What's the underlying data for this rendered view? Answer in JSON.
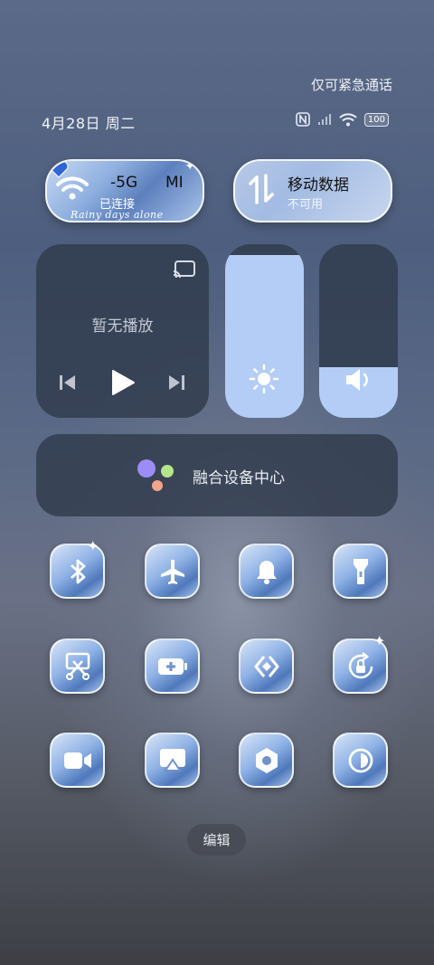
{
  "status": {
    "emergency_text": "仅可紧急通话",
    "date": "4月28日 周二",
    "battery": "100"
  },
  "wifi_tile": {
    "network": "-5G",
    "mi_text": "MI",
    "status": "已连接",
    "script_text": "Rainy days alone"
  },
  "mobile_data_tile": {
    "title": "移动数据",
    "status": "不可用"
  },
  "media": {
    "label": "暂无播放"
  },
  "brightness": {
    "level": 0.94
  },
  "volume": {
    "level": 0.29
  },
  "fusion": {
    "label": "融合设备中心"
  },
  "toggles": [
    {
      "icon": "bluetooth-icon"
    },
    {
      "icon": "airplane-icon"
    },
    {
      "icon": "bell-icon"
    },
    {
      "icon": "flashlight-icon"
    },
    {
      "icon": "screenshot-icon"
    },
    {
      "icon": "battery-saver-icon"
    },
    {
      "icon": "nfc-card-icon"
    },
    {
      "icon": "rotation-lock-icon"
    },
    {
      "icon": "screen-record-icon"
    },
    {
      "icon": "cast-icon"
    },
    {
      "icon": "settings-hex-icon"
    },
    {
      "icon": "dark-mode-icon"
    }
  ],
  "edit_label": "编辑"
}
